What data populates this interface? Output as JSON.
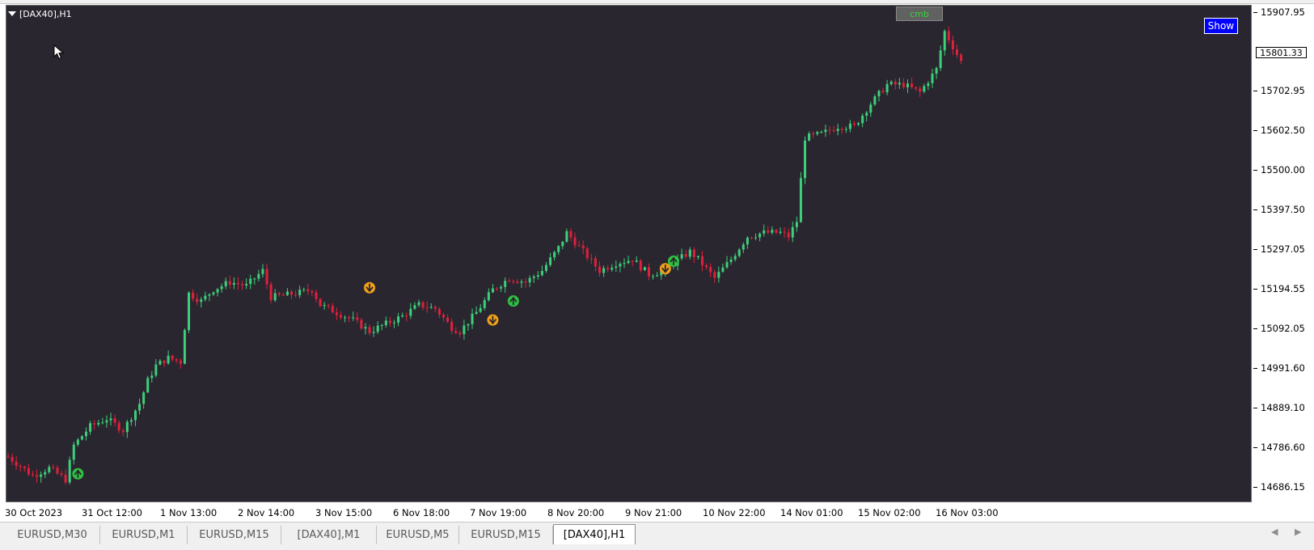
{
  "window": {
    "chart_title": "[DAX40],H1",
    "cmb_label": "cmb",
    "show_label": "Show"
  },
  "y_axis": {
    "labels": [
      "15907.95",
      "15801.33",
      "15702.95",
      "15602.50",
      "15500.00",
      "15397.50",
      "15297.05",
      "15194.55",
      "15092.05",
      "14991.60",
      "14889.10",
      "14786.60",
      "14686.15"
    ],
    "current_price": "15801.33"
  },
  "x_axis": {
    "labels": [
      "30 Oct 2023",
      "31 Oct 12:00",
      "1 Nov 13:00",
      "2 Nov 14:00",
      "3 Nov 15:00",
      "6 Nov 18:00",
      "7 Nov 19:00",
      "8 Nov 20:00",
      "9 Nov 21:00",
      "10 Nov 22:00",
      "14 Nov 01:00",
      "15 Nov 02:00",
      "16 Nov 03:00"
    ]
  },
  "tabs": [
    {
      "label": "EURUSD,M30",
      "active": false
    },
    {
      "label": "EURUSD,M1",
      "active": false
    },
    {
      "label": "EURUSD,M15",
      "active": false
    },
    {
      "label": "[DAX40],M1",
      "active": false
    },
    {
      "label": "EURUSD,M5",
      "active": false
    },
    {
      "label": "EURUSD,M15",
      "active": false
    },
    {
      "label": "[DAX40],H1",
      "active": true
    }
  ],
  "colors": {
    "background": "#29262f",
    "bull": "#3ecf7a",
    "bear": "#e0203c",
    "buy_signal": "#2fc142",
    "sell_signal": "#f0a018",
    "cmb_text": "#34d53b",
    "show_button": "#0000ff"
  },
  "chart_data": {
    "type": "candlestick",
    "symbol": "[DAX40]",
    "timeframe": "H1",
    "ylim": [
      14640,
      15950
    ],
    "close_path": [
      [
        0,
        14760
      ],
      [
        6,
        14710
      ],
      [
        10,
        14730
      ],
      [
        14,
        14700
      ],
      [
        16,
        14790
      ],
      [
        20,
        14840
      ],
      [
        24,
        14860
      ],
      [
        28,
        14830
      ],
      [
        32,
        14900
      ],
      [
        34,
        14960
      ],
      [
        36,
        15000
      ],
      [
        39,
        15020
      ],
      [
        42,
        15010
      ],
      [
        44,
        15190
      ],
      [
        47,
        15170
      ],
      [
        50,
        15200
      ],
      [
        54,
        15220
      ],
      [
        58,
        15210
      ],
      [
        62,
        15250
      ],
      [
        64,
        15180
      ],
      [
        70,
        15190
      ],
      [
        74,
        15200
      ],
      [
        76,
        15160
      ],
      [
        80,
        15140
      ],
      [
        84,
        15120
      ],
      [
        88,
        15090
      ],
      [
        92,
        15110
      ],
      [
        96,
        15130
      ],
      [
        100,
        15160
      ],
      [
        104,
        15150
      ],
      [
        108,
        15100
      ],
      [
        110,
        15090
      ],
      [
        114,
        15140
      ],
      [
        118,
        15200
      ],
      [
        122,
        15230
      ],
      [
        126,
        15220
      ],
      [
        130,
        15250
      ],
      [
        134,
        15310
      ],
      [
        136,
        15350
      ],
      [
        140,
        15300
      ],
      [
        144,
        15250
      ],
      [
        148,
        15270
      ],
      [
        152,
        15280
      ],
      [
        156,
        15240
      ],
      [
        160,
        15250
      ],
      [
        162,
        15270
      ],
      [
        166,
        15300
      ],
      [
        168,
        15280
      ],
      [
        172,
        15230
      ],
      [
        176,
        15280
      ],
      [
        180,
        15340
      ],
      [
        184,
        15350
      ],
      [
        188,
        15350
      ],
      [
        190,
        15340
      ],
      [
        192,
        15380
      ],
      [
        194,
        15600
      ],
      [
        198,
        15610
      ],
      [
        202,
        15630
      ],
      [
        206,
        15630
      ],
      [
        210,
        15690
      ],
      [
        214,
        15740
      ],
      [
        218,
        15740
      ],
      [
        222,
        15720
      ],
      [
        226,
        15780
      ],
      [
        228,
        15880
      ],
      [
        230,
        15840
      ],
      [
        232,
        15800
      ]
    ],
    "signals": [
      {
        "type": "buy",
        "index": 17,
        "price": 14715
      },
      {
        "type": "sell",
        "index": 88,
        "price": 15205
      },
      {
        "type": "sell",
        "index": 118,
        "price": 15120
      },
      {
        "type": "buy",
        "index": 123,
        "price": 15170
      },
      {
        "type": "sell",
        "index": 160,
        "price": 15255
      },
      {
        "type": "buy",
        "index": 162,
        "price": 15275
      }
    ]
  }
}
